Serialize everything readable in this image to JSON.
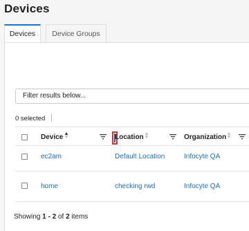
{
  "page": {
    "title": "Devices"
  },
  "tabs": [
    {
      "label": "Devices",
      "active": true
    },
    {
      "label": "Device Groups",
      "active": false
    }
  ],
  "filter": {
    "placeholder": "Filter results below..."
  },
  "selection": {
    "text": "0 selected"
  },
  "table": {
    "columns": [
      {
        "label": "Device",
        "sort": "ascending"
      },
      {
        "label": "Location",
        "sort": "none"
      },
      {
        "label": "Organization",
        "sort": "none"
      }
    ],
    "rows": [
      {
        "device": "ec2am",
        "location": "Default Location",
        "organization": "Infocyte QA"
      },
      {
        "device": "home",
        "location": "checking rwd",
        "organization": "Infocyte QA"
      }
    ]
  },
  "footer": {
    "prefix": "Showing ",
    "range": "1 - 2",
    "of": " of ",
    "total": "2",
    "suffix": " items"
  },
  "colors": {
    "accent": "#1a73c8",
    "link": "#1a6ecc",
    "highlight_border": "#d0332f"
  }
}
